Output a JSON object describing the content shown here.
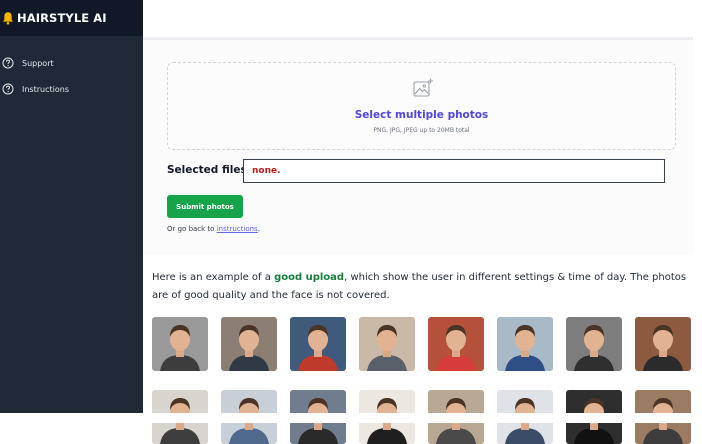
{
  "sidebar": {
    "brand_icon": "bell-icon",
    "brand": "HAIRSTYLE AI",
    "items": [
      {
        "icon": "help-circle-icon",
        "label": "Support"
      },
      {
        "icon": "help-circle-icon",
        "label": "Instructions"
      }
    ]
  },
  "upload": {
    "icon": "image-add-icon",
    "title": "Select multiple photos",
    "hint": "PNG, JPG, JPEG up to 20MB total"
  },
  "selected": {
    "label": "Selected files:",
    "value": "none."
  },
  "submit_label": "Submit photos",
  "goback": {
    "prefix": "Or go back to ",
    "link": "instructions",
    "suffix": "."
  },
  "example": {
    "before": "Here is an example of a ",
    "highlight": "good upload",
    "after": ", which show the user in different settings & time of day. The photos are of good quality and the face is not covered."
  },
  "colors": {
    "sidebar": "#1f2937",
    "brand_bar": "#111827",
    "accent": "#4f46e5",
    "submit": "#16a34a",
    "error": "#b91c1c",
    "highlight": "#15803d"
  },
  "photos": [
    {
      "bg": "#9a9a9a",
      "shirt": "#3d3d3d"
    },
    {
      "bg": "#8a7f72",
      "shirt": "#2f3a46"
    },
    {
      "bg": "#3f5a7a",
      "shirt": "#c03a2b"
    },
    {
      "bg": "#c9b9a6",
      "shirt": "#596069"
    },
    {
      "bg": "#b5503a",
      "shirt": "#d63c3c"
    },
    {
      "bg": "#a8b9c8",
      "shirt": "#2e4f86"
    },
    {
      "bg": "#7d7d7d",
      "shirt": "#2f2f2f"
    },
    {
      "bg": "#8d5a40",
      "shirt": "#2b2b2b"
    },
    {
      "bg": "#d8d5cf",
      "shirt": "#3e3e3e"
    },
    {
      "bg": "#c9cfd6",
      "shirt": "#4f6a8c"
    },
    {
      "bg": "#6f7d8e",
      "shirt": "#2a2a2a"
    },
    {
      "bg": "#ece8e1",
      "shirt": "#1f1f1f"
    },
    {
      "bg": "#b9a894",
      "shirt": "#4a4a4a"
    },
    {
      "bg": "#dfe3e8",
      "shirt": "#3b4d66"
    },
    {
      "bg": "#2e2e2e",
      "shirt": "#111111"
    },
    {
      "bg": "#9b7c62",
      "shirt": "#3d3d3d"
    }
  ]
}
